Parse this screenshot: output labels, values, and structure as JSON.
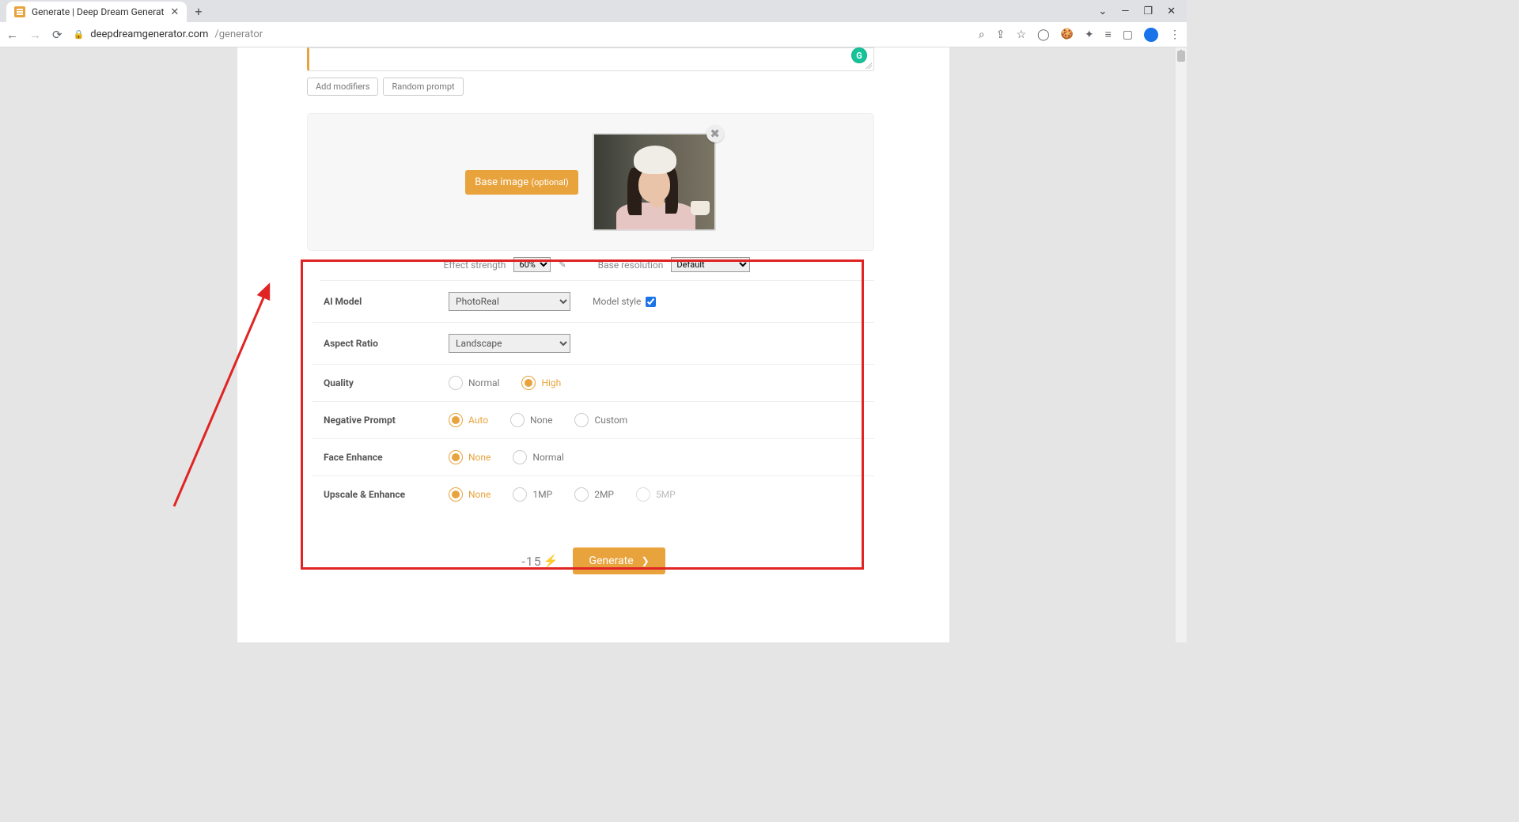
{
  "browser": {
    "tab_title": "Generate | Deep Dream Generat",
    "url_host": "deepdreamgenerator.com",
    "url_path": "/generator"
  },
  "prompt_buttons": {
    "add_modifiers": "Add modifiers",
    "random_prompt": "Random prompt"
  },
  "base_image": {
    "button_label": "Base image ",
    "button_optional": "(optional)"
  },
  "effect": {
    "strength_label": "Effect strength",
    "strength_value": "60%",
    "base_resolution_label": "Base resolution",
    "base_resolution_value": "Default"
  },
  "settings": {
    "ai_model": {
      "label": "AI Model",
      "value": "PhotoReal",
      "style_label": "Model style",
      "style_checked": true
    },
    "aspect_ratio": {
      "label": "Aspect Ratio",
      "value": "Landscape"
    },
    "quality": {
      "label": "Quality",
      "options": [
        "Normal",
        "High"
      ],
      "selected": "High"
    },
    "negative_prompt": {
      "label": "Negative Prompt",
      "options": [
        "Auto",
        "None",
        "Custom"
      ],
      "selected": "Auto"
    },
    "face_enhance": {
      "label": "Face Enhance",
      "options": [
        "None",
        "Normal"
      ],
      "selected": "None"
    },
    "upscale": {
      "label": "Upscale & Enhance",
      "options": [
        "None",
        "1MP",
        "2MP",
        "5MP"
      ],
      "selected": "None",
      "disabled": [
        "5MP"
      ]
    }
  },
  "generate": {
    "cost": "-15",
    "button_label": "Generate"
  }
}
